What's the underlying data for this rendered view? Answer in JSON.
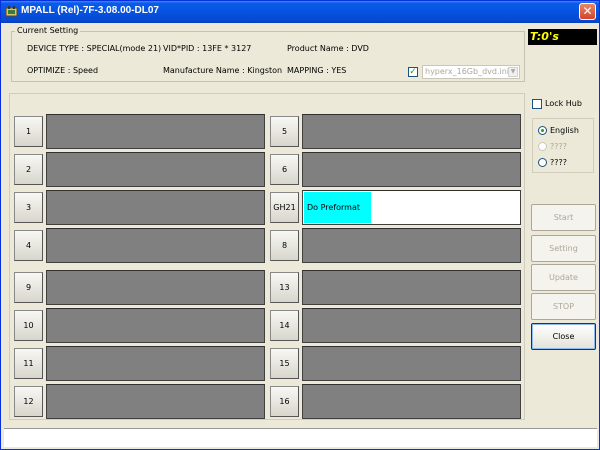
{
  "window": {
    "title": "MPALL (Rel)-7F-3.08.00-DL07",
    "close_glyph": "✕"
  },
  "timer": {
    "text": "T:0's"
  },
  "current_setting": {
    "label": "Current Setting",
    "device_type": "DEVICE TYPE : SPECIAL(mode 21)",
    "vid_pid": "VID*PID : 13FE * 3127",
    "product_name": "Product Name : DVD",
    "optimize": "OPTIMIZE : Speed",
    "manufacture_name": "Manufacture Name : Kingston",
    "mapping": "MAPPING : YES",
    "ini_checked": true,
    "ini_file": "hyperx_16Gb_dvd.ini"
  },
  "ports": [
    {
      "label": "1",
      "status": ""
    },
    {
      "label": "2",
      "status": ""
    },
    {
      "label": "3",
      "status": ""
    },
    {
      "label": "4",
      "status": ""
    },
    {
      "label": "5",
      "status": ""
    },
    {
      "label": "6",
      "status": ""
    },
    {
      "label": "GH21",
      "status": "Do Preformat",
      "progress": 0.31
    },
    {
      "label": "8",
      "status": ""
    },
    {
      "label": "9",
      "status": ""
    },
    {
      "label": "10",
      "status": ""
    },
    {
      "label": "11",
      "status": ""
    },
    {
      "label": "12",
      "status": ""
    },
    {
      "label": "13",
      "status": ""
    },
    {
      "label": "14",
      "status": ""
    },
    {
      "label": "15",
      "status": ""
    },
    {
      "label": "16",
      "status": ""
    }
  ],
  "lock_hub": {
    "label": "Lock Hub",
    "checked": false
  },
  "languages": [
    {
      "label": "English",
      "selected": true,
      "enabled": true
    },
    {
      "label": "????",
      "selected": false,
      "enabled": false
    },
    {
      "label": "????",
      "selected": false,
      "enabled": true
    }
  ],
  "buttons": {
    "start": "Start",
    "setting": "Setting",
    "update": "Update",
    "stop": "STOP",
    "close": "Close"
  },
  "colors": {
    "slot_idle": "#808080",
    "slot_progress": "#00FFFF",
    "timer_bg": "#000000",
    "timer_fg": "#FFFF00",
    "titlebar": "#0653E0"
  }
}
